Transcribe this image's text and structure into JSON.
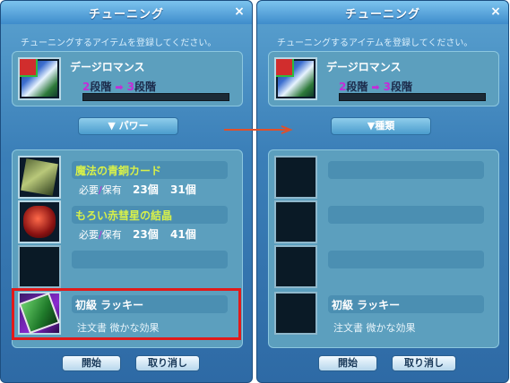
{
  "windows": [
    {
      "title": "チューニング",
      "close": "×",
      "instruction": "チューニングするアイテムを登録してください。",
      "item": {
        "name": "デージロマンス",
        "stage_from": "2",
        "stage_from_word": "段階",
        "stage_to": "3",
        "stage_to_word": "段階"
      },
      "category_button": "▼ パワー",
      "materials": [
        {
          "name": "魔法の青銅カード",
          "req_label": "必要",
          "sep": "/",
          "have_label": "保有",
          "required": "23個",
          "owned": "31個"
        },
        {
          "name": "もろい赤彗星の結晶",
          "req_label": "必要",
          "sep": "/",
          "have_label": "保有",
          "required": "23個",
          "owned": "41個"
        },
        {
          "name": ""
        },
        {
          "name": "初級 ラッキー",
          "desc": "注文書 微かな効果"
        }
      ],
      "buttons": {
        "start": "開始",
        "cancel": "取り消し"
      }
    },
    {
      "title": "チューニング",
      "close": "×",
      "instruction": "チューニングするアイテムを登録してください。",
      "item": {
        "name": "デージロマンス",
        "stage_from": "2",
        "stage_from_word": "段階",
        "stage_to": "3",
        "stage_to_word": "段階"
      },
      "category_button": "▼種類",
      "materials": [
        {
          "name": ""
        },
        {
          "name": ""
        },
        {
          "name": ""
        },
        {
          "name": "初級 ラッキー",
          "desc": "注文書 微かな効果"
        }
      ],
      "buttons": {
        "start": "開始",
        "cancel": "取り消し"
      }
    }
  ],
  "arrow_icon": "arrow-right-icon",
  "colors": {
    "window_blue": "#3b7fb8",
    "panel": "#5c9fbe",
    "material_name": "#d7f04a",
    "stage_purple": "#c42cd8",
    "highlight_red": "#e11a1a",
    "arrow_red": "#e0502a"
  }
}
